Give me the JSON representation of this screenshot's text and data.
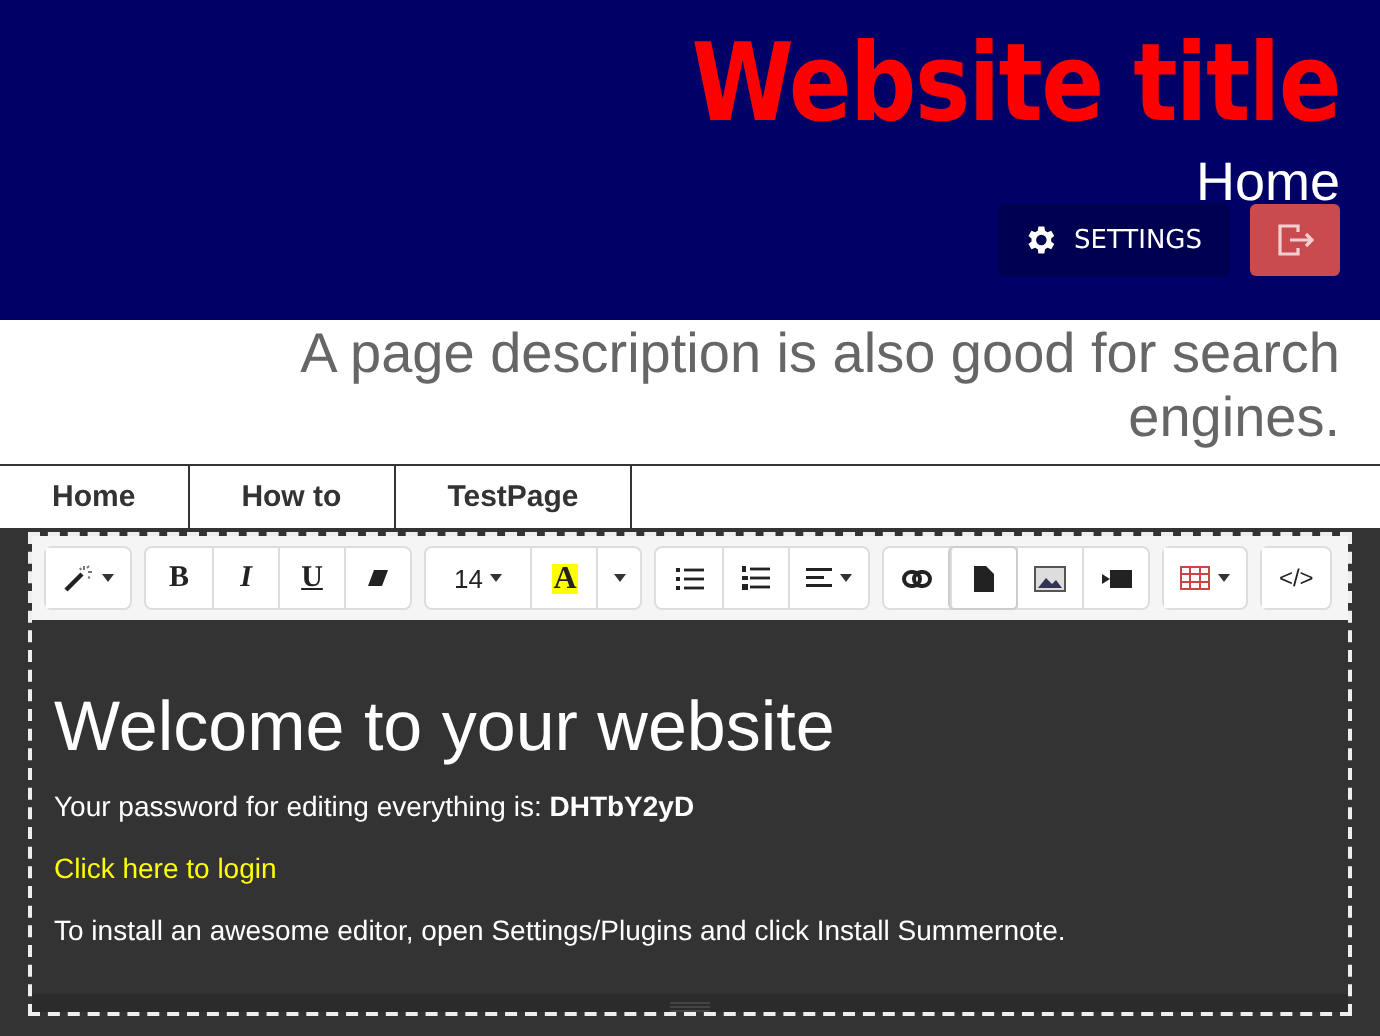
{
  "header": {
    "title": "Website title",
    "page": "Home",
    "settings_button": "SETTINGS"
  },
  "description": "A page description is also good for search engines.",
  "nav": [
    {
      "label": "Home"
    },
    {
      "label": "How to"
    },
    {
      "label": "TestPage"
    }
  ],
  "toolbar": [
    [
      {
        "kind": "magic",
        "dropdown": true,
        "active": false
      }
    ],
    [
      {
        "kind": "bold",
        "label": "B",
        "active": false
      },
      {
        "kind": "italic",
        "label": "I",
        "active": false
      },
      {
        "kind": "underline",
        "label": "U",
        "active": false
      },
      {
        "kind": "eraser",
        "active": false
      }
    ],
    [
      {
        "kind": "size",
        "label": "14",
        "dropdown": true,
        "active": false
      },
      {
        "kind": "color",
        "label": "A",
        "active": false
      },
      {
        "kind": "caret",
        "active": false
      }
    ],
    [
      {
        "kind": "ul",
        "active": false
      },
      {
        "kind": "ol",
        "active": false
      },
      {
        "kind": "align",
        "dropdown": true,
        "active": false
      }
    ],
    [
      {
        "kind": "link",
        "active": false
      },
      {
        "kind": "file",
        "active": true
      },
      {
        "kind": "image",
        "active": false
      },
      {
        "kind": "video",
        "active": false
      }
    ],
    [
      {
        "kind": "table",
        "dropdown": true,
        "active": false
      }
    ],
    [
      {
        "kind": "code",
        "label": "</>",
        "active": false
      }
    ]
  ],
  "content": {
    "heading": "Welcome to your website",
    "password_line": "Your password for editing everything is: **DHTbY2yD**",
    "login_link": "Click here to login",
    "install_note": "To install an awesome editor, open Settings/Plugins and click Install Summernote."
  }
}
